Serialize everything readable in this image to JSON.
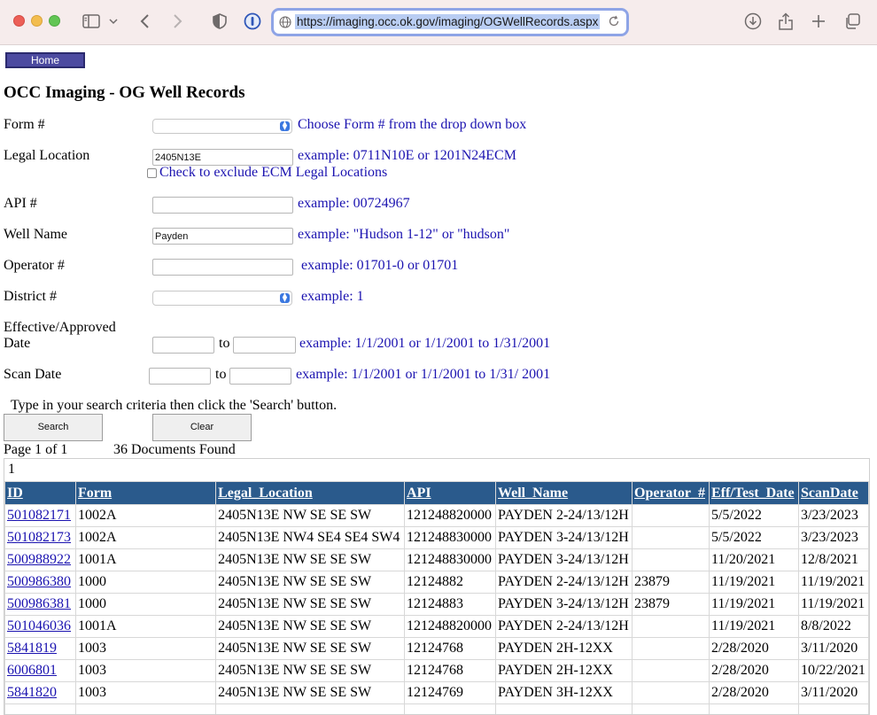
{
  "browser": {
    "url": "https://imaging.occ.ok.gov/imaging/OGWellRecords.aspx"
  },
  "page": {
    "home_label": "Home",
    "title": "OCC Imaging - OG Well Records"
  },
  "form": {
    "form_no": {
      "label": "Form #",
      "value": "",
      "hint": "Choose Form # from the drop down box"
    },
    "legal_location": {
      "label": "Legal Location",
      "value": "2405N13E",
      "hint": "example: 0711N10E or 1201N24ECM",
      "exclude_label": "Check to exclude ECM Legal Locations",
      "exclude_checked": false
    },
    "api": {
      "label": "API #",
      "value": "",
      "hint": "example: 00724967"
    },
    "well_name": {
      "label": "Well Name",
      "value": "Payden",
      "hint": "example: \"Hudson 1-12\" or \"hudson\""
    },
    "operator": {
      "label": "Operator #",
      "value": "",
      "hint": "example: 01701-0 or 01701"
    },
    "district": {
      "label": "District #",
      "value": "",
      "hint": "example: 1"
    },
    "effective_date": {
      "label_line1": "Effective/Approved",
      "label_line2": "Date",
      "from": "",
      "to_label": "to",
      "to": "",
      "hint": "example: 1/1/2001 or 1/1/2001 to 1/31/2001"
    },
    "scan_date": {
      "label": "Scan Date",
      "from": "",
      "to_label": "to",
      "to": "",
      "hint": "example: 1/1/2001 or 1/1/2001 to 1/31/ 2001"
    },
    "instructions": "Type in your search criteria then click the 'Search' button.",
    "search_label": "Search",
    "clear_label": "Clear"
  },
  "results": {
    "page_info": "Page 1 of 1",
    "count_text": "36 Documents Found",
    "pager": "1",
    "columns": [
      "ID",
      "Form",
      "Legal_Location",
      "API",
      "Well_Name",
      "Operator_#",
      "Eff/Test_Date",
      "ScanDate"
    ],
    "rows": [
      [
        "501082171",
        "1002A",
        "2405N13E NW SE SE SW",
        "121248820000",
        "PAYDEN 2-24/13/12H",
        "",
        "5/5/2022",
        "3/23/2023"
      ],
      [
        "501082173",
        "1002A",
        "2405N13E NW4 SE4 SE4 SW4",
        "121248830000",
        "PAYDEN 3-24/13/12H",
        "",
        "5/5/2022",
        "3/23/2023"
      ],
      [
        "500988922",
        "1001A",
        "2405N13E NW SE SE SW",
        "121248830000",
        "PAYDEN 3-24/13/12H",
        "",
        "11/20/2021",
        "12/8/2021"
      ],
      [
        "500986380",
        "1000",
        "2405N13E NW SE SE SW",
        "12124882",
        "PAYDEN 2-24/13/12H",
        "23879",
        "11/19/2021",
        "11/19/2021"
      ],
      [
        "500986381",
        "1000",
        "2405N13E NW SE SE SW",
        "12124883",
        "PAYDEN 3-24/13/12H",
        "23879",
        "11/19/2021",
        "11/19/2021"
      ],
      [
        "501046036",
        "1001A",
        "2405N13E NW SE SE SW",
        "121248820000",
        "PAYDEN 2-24/13/12H",
        "",
        "11/19/2021",
        "8/8/2022"
      ],
      [
        "5841819",
        "1003",
        "2405N13E NW SE SE SW",
        "12124768",
        "PAYDEN 2H-12XX",
        "",
        "2/28/2020",
        "3/11/2020"
      ],
      [
        "6006801",
        "1003",
        "2405N13E NW SE SE SW",
        "12124768",
        "PAYDEN 2H-12XX",
        "",
        "2/28/2020",
        "10/22/2021"
      ],
      [
        "5841820",
        "1003",
        "2405N13E NW SE SE SW",
        "12124769",
        "PAYDEN 3H-12XX",
        "",
        "2/28/2020",
        "3/11/2020"
      ],
      [
        "",
        "",
        "",
        "",
        "",
        "",
        "",
        ""
      ]
    ]
  }
}
